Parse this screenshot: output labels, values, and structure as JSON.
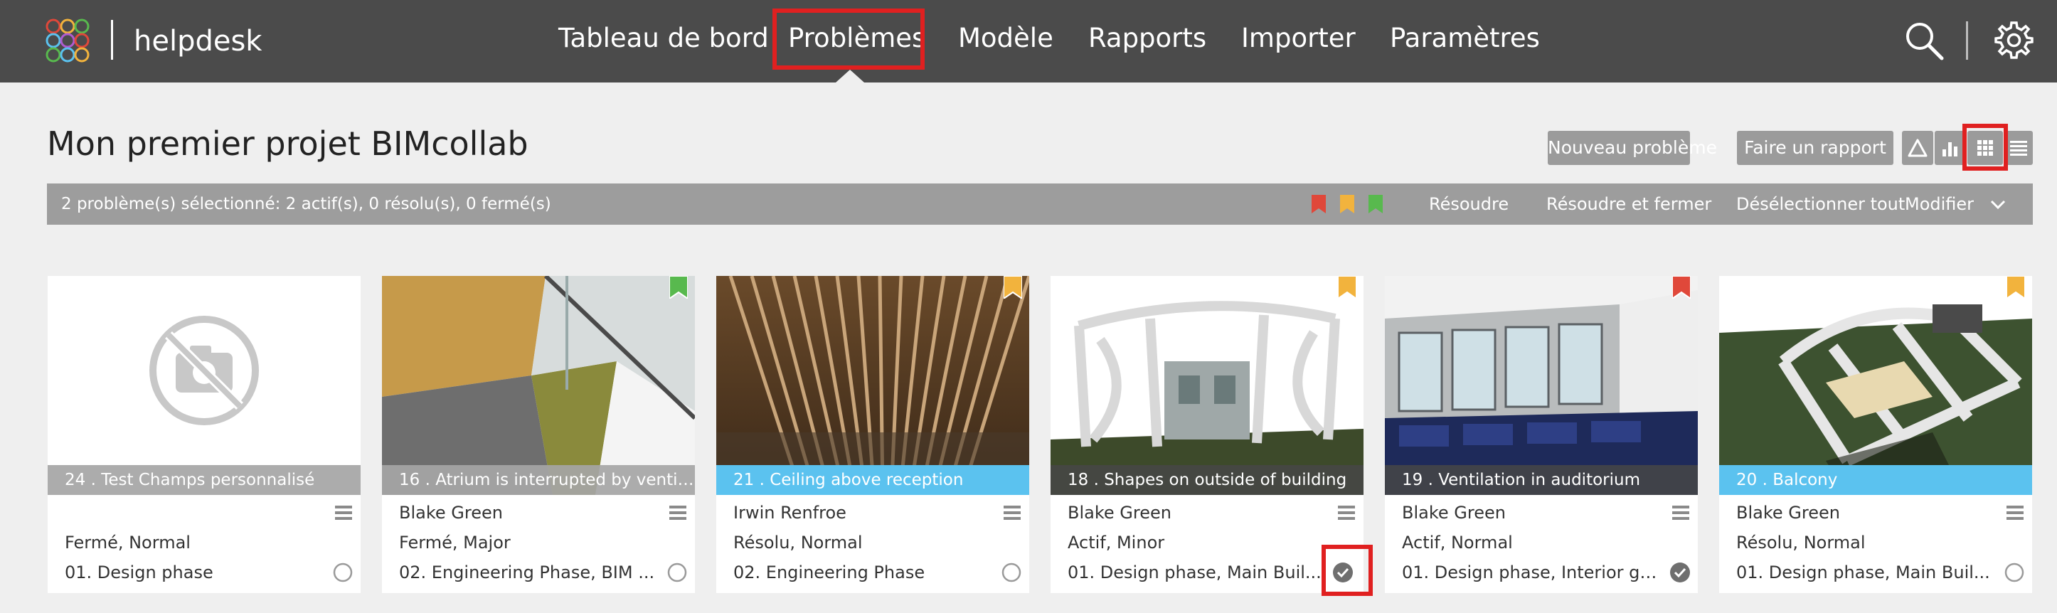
{
  "header": {
    "brand": "helpdesk",
    "nav": [
      "Tableau de bord",
      "Problèmes",
      "Modèle",
      "Rapports",
      "Importer",
      "Paramètres"
    ],
    "active_nav": "Problèmes"
  },
  "project": {
    "title": "Mon premier projet BIMcollab",
    "new_issue_label": "Nouveau problème",
    "report_label": "Faire un rapport"
  },
  "selection": {
    "summary": "2 problème(s) sélectionné: 2 actif(s), 0 résolu(s), 0 fermé(s)",
    "actions": [
      "Résoudre",
      "Résoudre et fermer",
      "Désélectionner tout",
      "Modifier"
    ]
  },
  "colors": {
    "topbar": "#4b4b4b",
    "highlight": "#e02020",
    "flag_red": "#e0483a",
    "flag_orange": "#f2b33d",
    "flag_green": "#58b94e",
    "caption_blue": "#5bc2ef"
  },
  "cards": [
    {
      "caption": "24 . Test Champs personnalisé",
      "assignee": "",
      "status": "Fermé, Normal",
      "phase": "01. Design phase",
      "flag": "none",
      "selected": false
    },
    {
      "caption": "16 . Atrium is interrupted by ventil...",
      "assignee": "Blake Green",
      "status": "Fermé, Major",
      "phase": "02. Engineering Phase, BIM ...",
      "flag": "green",
      "selected": false
    },
    {
      "caption": "21 . Ceiling above reception",
      "assignee": "Irwin Renfroe",
      "status": "Résolu, Normal",
      "phase": "02. Engineering Phase",
      "flag": "orange",
      "selected": false
    },
    {
      "caption": "18 . Shapes on outside of building",
      "assignee": "Blake Green",
      "status": "Actif, Minor",
      "phase": "01. Design phase, Main Buil...",
      "flag": "orange",
      "selected": true
    },
    {
      "caption": "19 . Ventilation in auditorium",
      "assignee": "Blake Green",
      "status": "Actif, Normal",
      "phase": "01. Design phase, Interior ge...",
      "flag": "red",
      "selected": true
    },
    {
      "caption": "20 . Balcony",
      "assignee": "Blake Green",
      "status": "Résolu, Normal",
      "phase": "01. Design phase, Main Buil...",
      "flag": "orange",
      "selected": false
    }
  ]
}
